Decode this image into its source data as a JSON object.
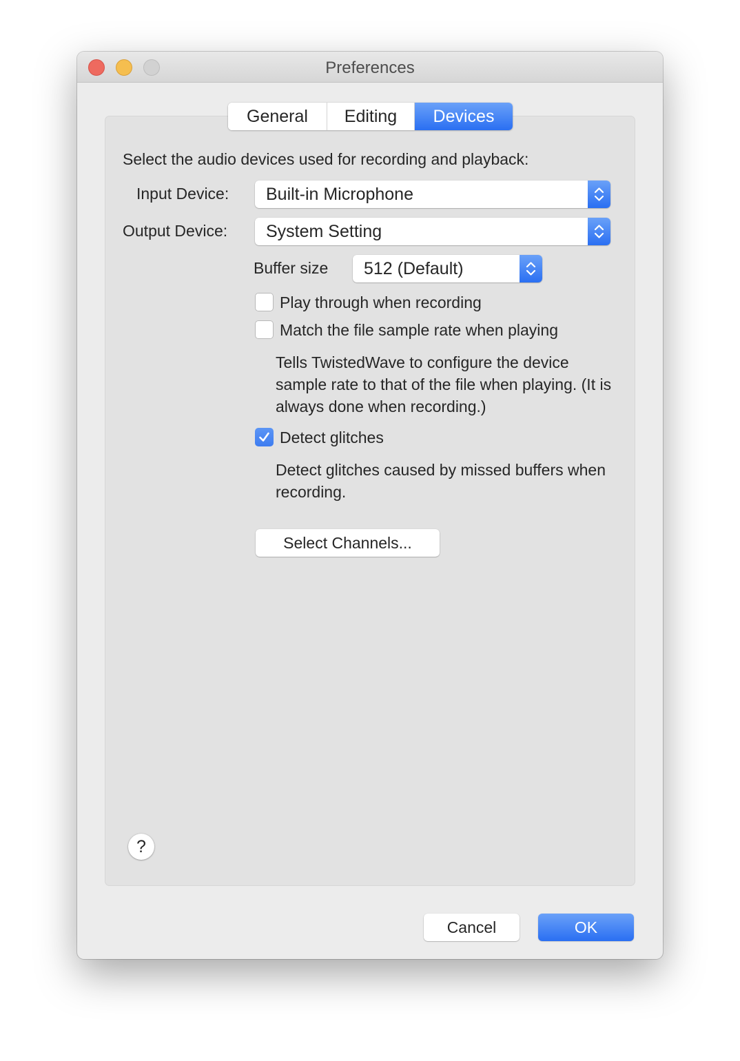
{
  "window": {
    "title": "Preferences",
    "controls": [
      "close",
      "minimize",
      "zoom"
    ]
  },
  "tabs": [
    {
      "label": "General",
      "selected": false
    },
    {
      "label": "Editing",
      "selected": false
    },
    {
      "label": "Devices",
      "selected": true
    }
  ],
  "devices": {
    "intro": "Select the audio devices used for recording and playback:",
    "input_device": {
      "label": "Input Device:",
      "value": "Built-in Microphone"
    },
    "output_device": {
      "label": "Output Device:",
      "value": "System Setting"
    },
    "buffer_size": {
      "label": "Buffer size",
      "value": "512 (Default)"
    },
    "options": [
      {
        "label": "Play through when recording",
        "checked": false
      },
      {
        "label": "Match the file sample rate when playing",
        "checked": false,
        "description": "Tells TwistedWave to configure the device sample rate to that of the file when playing. (It is always done when recording.)"
      },
      {
        "label": "Detect glitches",
        "checked": true,
        "description": "Detect glitches caused by missed buffers when recording."
      }
    ],
    "select_channels_label": "Select Channels..."
  },
  "help": {
    "icon": "question-mark-icon",
    "label": "?"
  },
  "footer": {
    "cancel_label": "Cancel",
    "ok_label": "OK"
  },
  "colors": {
    "accent": "#3478f6",
    "close": "#ee6a5f",
    "minimize": "#f5be4f",
    "zoom_inactive": "#d2d2d2"
  }
}
